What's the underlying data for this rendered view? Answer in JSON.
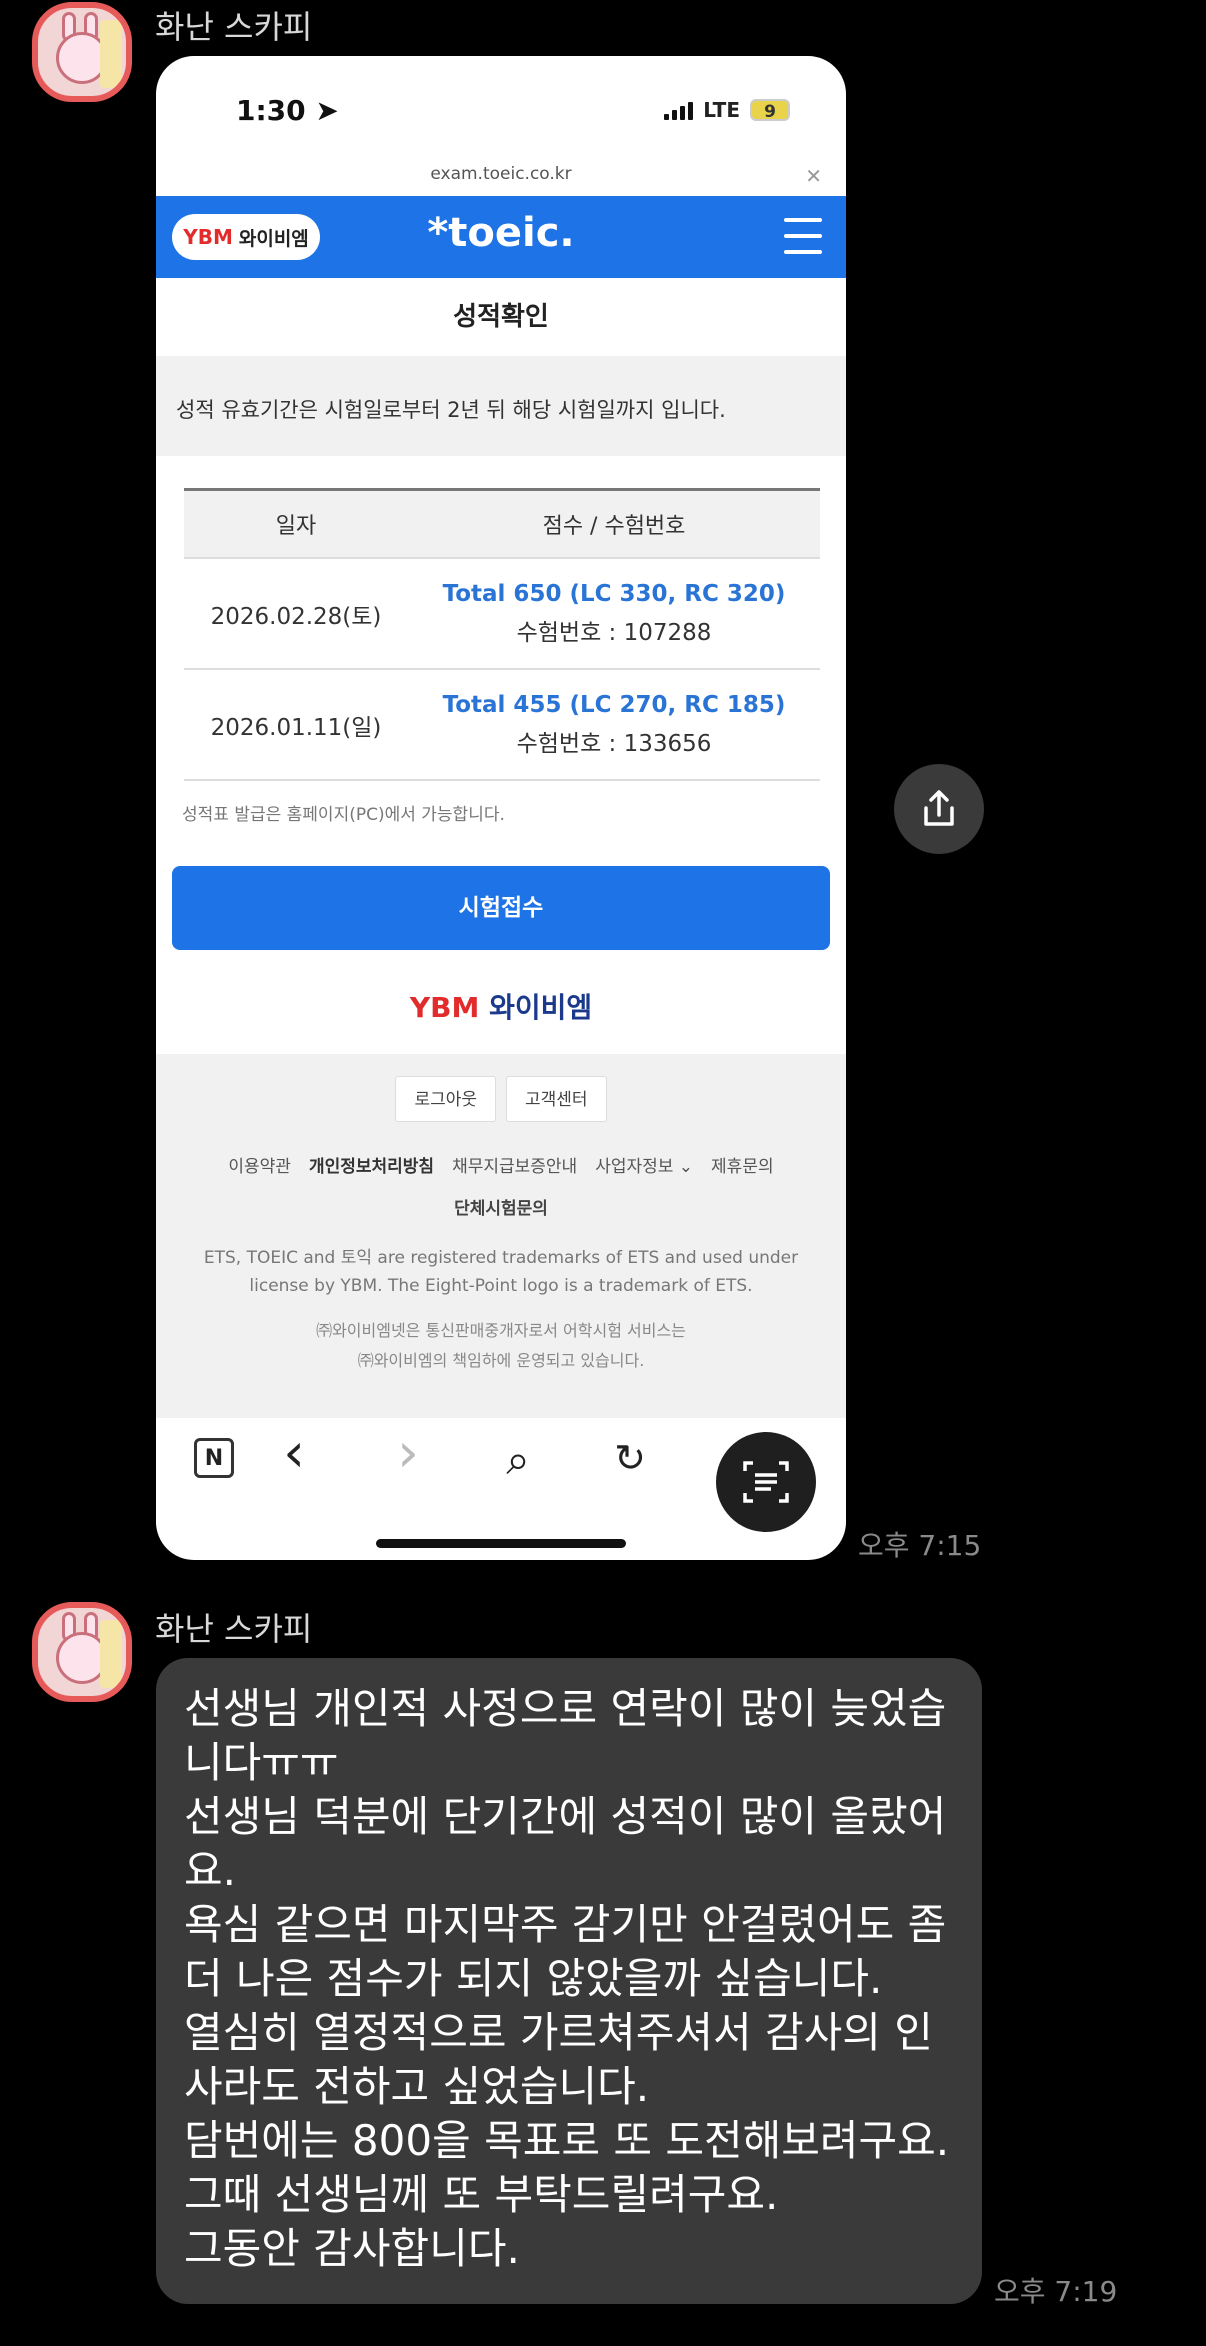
{
  "messages": [
    {
      "sender": "화난 스카피",
      "time": "오후 7:15"
    },
    {
      "sender": "화난 스카피",
      "time": "오후 7:19",
      "lines": [
        "선생님 개인적 사정으로 연락이 많이 늦었습",
        "니다ㅠㅠ",
        "선생님 덕분에 단기간에 성적이 많이 올랐어",
        "요.",
        "욕심 같으면 마지막주 감기만 안걸렸어도 좀",
        "더 나은 점수가  되지 않았을까 싶습니다.",
        "열심히 열정적으로 가르쳐주셔서 감사의 인",
        "사라도 전하고 싶었습니다.",
        "담번에는 800을 목표로 또 도전해보려구요.",
        "그때 선생님께 또 부탁드릴려구요.",
        "그동안 감사합니다."
      ]
    }
  ],
  "screenshot": {
    "status": {
      "time": "1:30",
      "network": "LTE",
      "battery": "9"
    },
    "url": "exam.toeic.co.kr",
    "brand_pill": {
      "mark": "YBM",
      "text": "와이비엠"
    },
    "brand_center": "*toeic.",
    "page_title": "성적확인",
    "notice": "성적 유효기간은 시험일로부터 2년 뒤 해당 시험일까지 입니다.",
    "table": {
      "headers": [
        "일자",
        "점수 / 수험번호"
      ],
      "rows": [
        {
          "date": "2026.02.28(토)",
          "score": "Total 650 (LC 330, RC 320)",
          "number": "수험번호 : 107288"
        },
        {
          "date": "2026.01.11(일)",
          "score": "Total 455 (LC 270, RC 185)",
          "number": "수험번호 : 133656"
        }
      ]
    },
    "note": "성적표 발급은 홈페이지(PC)에서 가능합니다.",
    "exam_button": "시험접수",
    "footer_logo": {
      "mark": "YBM",
      "text": "와이비엠"
    },
    "footer_buttons": [
      "로그아웃",
      "고객센터"
    ],
    "footer_links": [
      "이용약관",
      "개인정보처리방침",
      "채무지급보증안내",
      "사업자정보 ⌄",
      "제휴문의"
    ],
    "footer_link2": "단체시험문의",
    "legal": [
      "ETS, TOEIC and 토익 are registered trademarks of ETS and used under",
      "license by YBM. The Eight-Point logo is a trademark of ETS."
    ],
    "legal2": [
      "㈜와이비엠넷은 통신판매중개자로서 어학시험 서비스는",
      "㈜와이비엠의 책임하에 운영되고 있습니다."
    ],
    "toolbar": {
      "n": "N",
      "back": "‹",
      "forward": "›",
      "search": "⌕",
      "reload": "↻"
    }
  }
}
